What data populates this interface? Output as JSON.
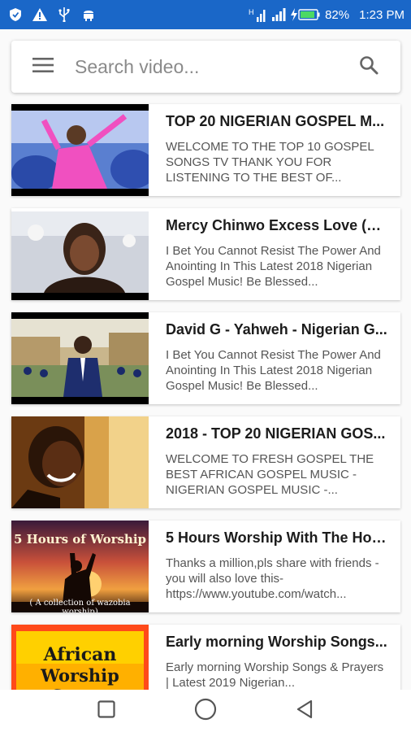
{
  "status_bar": {
    "left_icons": [
      "shield-icon",
      "warning-icon",
      "usb-icon",
      "android-icon"
    ],
    "network": "H",
    "battery_percent": "82%",
    "time": "1:23 PM"
  },
  "search": {
    "placeholder": "Search video...",
    "value": ""
  },
  "videos": [
    {
      "title": "TOP 20 NIGERIAN GOSPEL M...",
      "description": "WELCOME TO THE TOP 10 GOSPEL SONGS TV THANK YOU FOR LISTENING TO THE BEST OF..."
    },
    {
      "title": "Mercy Chinwo Excess Love (X...",
      "description": "I Bet You Cannot Resist The Power And Anointing In This Latest 2018 Nigerian Gospel Music! Be Blessed..."
    },
    {
      "title": "David G - Yahweh - Nigerian G...",
      "description": "I Bet You Cannot Resist The Power And Anointing In This Latest 2018 Nigerian Gospel Music! Be Blessed..."
    },
    {
      "title": "2018 - TOP 20 NIGERIAN GOS...",
      "description": "WELCOME TO FRESH GOSPEL THE BEST AFRICAN GOSPEL MUSIC - NIGERIAN GOSPEL MUSIC -..."
    },
    {
      "title": "5 Hours Worship With The Hol...",
      "description": "Thanks a million,pls share with friends - you will also love this- https://www.youtube.com/watch...",
      "thumb_text_top": "5 Hours of Worship",
      "thumb_text_bottom": "( A collection of wazobia worship)"
    },
    {
      "title": "Early morning Worship Songs...",
      "description": "Early morning Worship Songs & Prayers | Latest 2019 Nigerian...",
      "thumb_text_top": "African",
      "thumb_text_bottom": "Worship Songs"
    }
  ],
  "colors": {
    "status_bar": "#1a67c8",
    "background": "#fafafa",
    "title_text": "#1c1c1c",
    "desc_text": "#555555"
  }
}
